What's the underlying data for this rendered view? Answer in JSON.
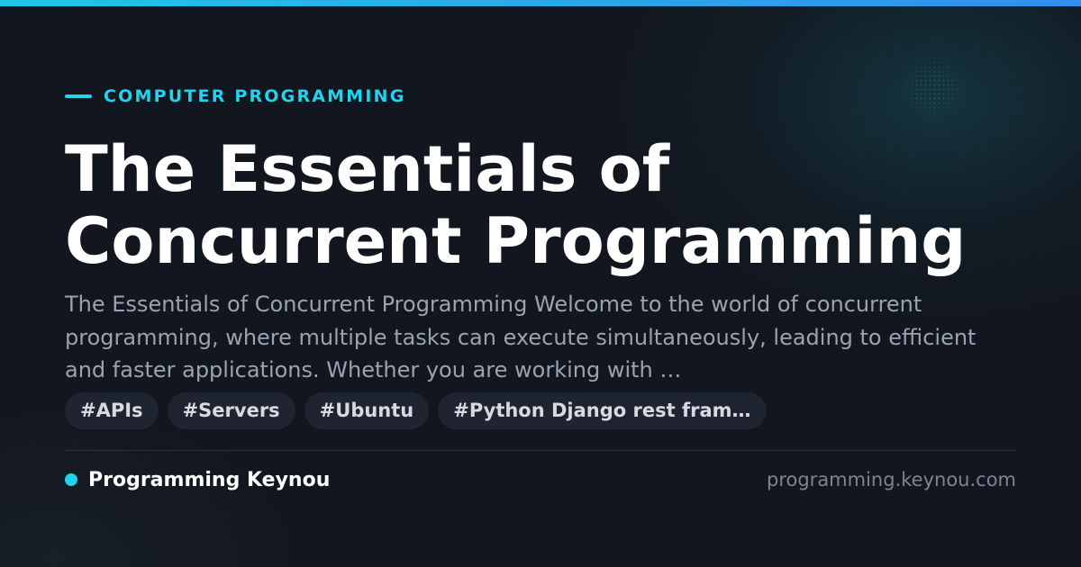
{
  "colors": {
    "accent": "#22d3ee",
    "background": "#12161e",
    "title": "#ffffff",
    "excerpt": "#9aa3b2",
    "tag_background": "#1f2530",
    "top_bar_gradient": [
      "#22c4e6",
      "#2f8ff0"
    ]
  },
  "category": "COMPUTER PROGRAMMING",
  "title": "The Essentials of Concurrent Programming",
  "excerpt": "The Essentials of Concurrent Programming Welcome to the world of concurrent programming, where multiple tasks can execute simultaneously, leading to efficient and faster applications. Whether you are working with …",
  "tags": [
    "#APIs",
    "#Servers",
    "#Ubuntu",
    "#Python Django rest fram…"
  ],
  "footer": {
    "brand_name": "Programming Keynou",
    "domain": "programming.keynou.com"
  }
}
